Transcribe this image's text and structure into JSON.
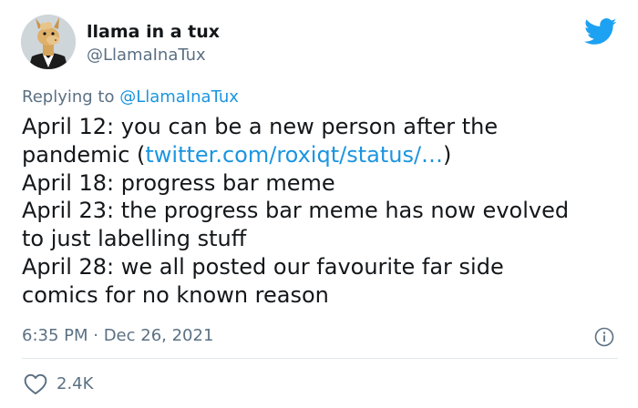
{
  "author": {
    "display_name": "llama in a tux",
    "handle": "@LlamaInaTux"
  },
  "reply": {
    "prefix": "Replying to ",
    "mention": "@LlamaInaTux"
  },
  "tweet": {
    "line1": "April 12: you can be a new person after the",
    "line2_before": "pandemic (",
    "line2_link": "twitter.com/roxiqt/status/…",
    "line2_after": ")",
    "line3": "April 18: progress bar meme",
    "line4": "April 23: the progress bar meme has now evolved",
    "line5": "to just labelling stuff",
    "line6": "April 28: we all posted our favourite far side",
    "line7": "comics for no known reason"
  },
  "meta": {
    "timestamp": "6:35 PM · Dec 26, 2021"
  },
  "engagement": {
    "likes": "2.4K"
  },
  "icons": {
    "bird": "twitter-bird-icon",
    "info": "info-icon",
    "heart": "heart-icon"
  },
  "colors": {
    "link": "#1b95e0",
    "twitter_blue": "#1da1f2",
    "secondary_text": "#5b7083",
    "divider": "#e1e8ed"
  }
}
